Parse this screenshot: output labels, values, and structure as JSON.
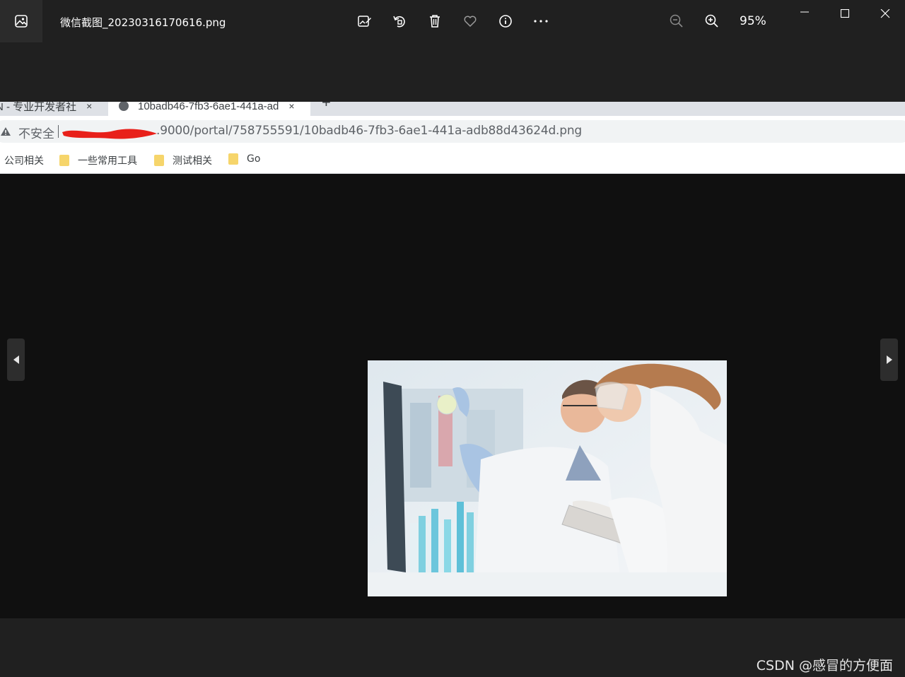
{
  "window": {
    "file_name": "微信截图_20230316170616.png",
    "zoom_level": "95%"
  },
  "toolbar": {
    "icons": [
      "edit-image-icon",
      "rotate-icon",
      "delete-icon",
      "favorite-heart-icon",
      "info-icon",
      "more-icon"
    ],
    "zoom_out_icon": "zoom-out-icon",
    "zoom_in_icon": "zoom-in-icon"
  },
  "browser": {
    "tabs": [
      {
        "label": "N - 专业开发者社",
        "close": "×"
      },
      {
        "label": "10badb46-7fb3-6ae1-441a-ad",
        "close": "×"
      }
    ],
    "new_tab": "+",
    "security_label": "不安全",
    "url_visible": ".9000/portal/758755591/10badb46-7fb3-6ae1-441a-adb88d43624d.png",
    "bookmarks": [
      "公司相关",
      "一些常用工具",
      "测试相关",
      "Go"
    ]
  },
  "watermark": "CSDN @感冒的方便面",
  "colors": {
    "titlebar_bg": "#202020",
    "viewer_bg": "#101010",
    "redaction": "#e8201a",
    "folder": "#f6d56b"
  }
}
